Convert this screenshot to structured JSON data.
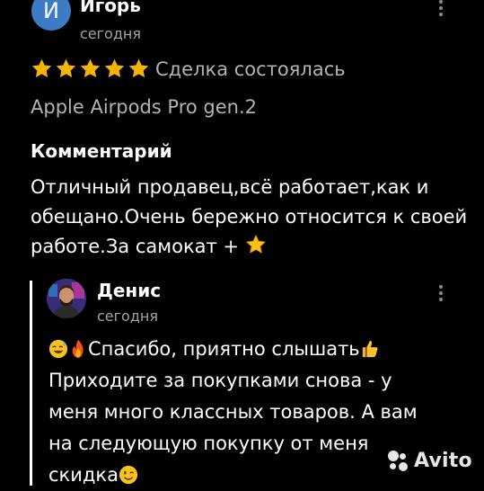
{
  "review": {
    "author": {
      "initial": "И",
      "name": "Игорь",
      "date": "сегодня"
    },
    "rating": 5,
    "status": "Сделка состоялась",
    "product": "Apple Airpods Pro gen.2",
    "comment_heading": "Комментарий",
    "comment_text": "Отличный продавец,всё работает,как и обещано.Очень бережно относится к своей работе.За самокат + "
  },
  "reply": {
    "author": {
      "name": "Денис",
      "date": "сегодня"
    },
    "text_part1": "Спасибо, приятно слышать",
    "text_part2": " Приходите за покупками снова - у меня много классных товаров. А вам на следующую покупку от меня скидка"
  },
  "brand": {
    "logo_text": "Avito",
    "star_color": "#f5b400"
  }
}
